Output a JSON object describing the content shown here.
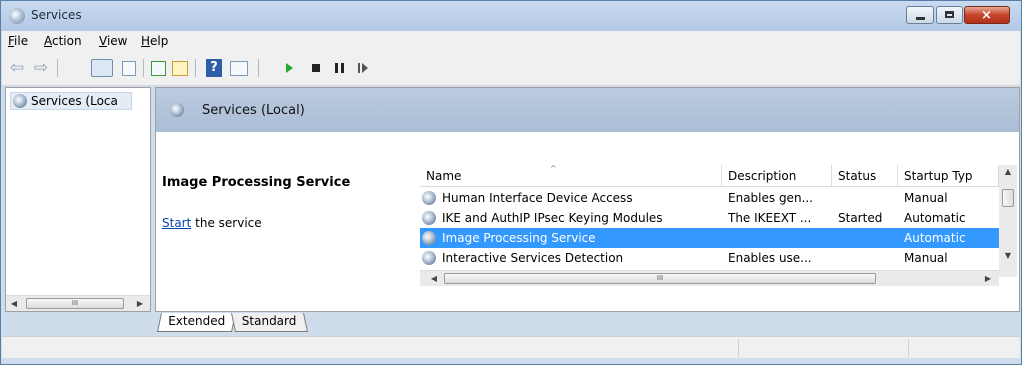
{
  "window": {
    "title": "Services",
    "caption_buttons": {
      "minimize": "minimize",
      "maximize": "maximize",
      "close": "×"
    }
  },
  "menubar": {
    "items": [
      "File",
      "Action",
      "View",
      "Help"
    ]
  },
  "toolbar": {
    "buttons": [
      "back-icon",
      "forward-icon",
      "show-hide-console-tree-icon",
      "properties-icon",
      "refresh-icon",
      "export-list-icon",
      "help-icon",
      "show-hide-action-pane-icon",
      "start-service-icon",
      "stop-service-icon",
      "pause-service-icon",
      "restart-service-icon"
    ],
    "help_glyph": "?"
  },
  "tree": {
    "item_label": "Services (Loca",
    "scroll_thumb": "III"
  },
  "main": {
    "header_title": "Services (Local)",
    "selected_service": "Image Processing Service",
    "action_link": "Start",
    "action_rest": " the service"
  },
  "list": {
    "columns": [
      "Name",
      "Description",
      "Status",
      "Startup Typ"
    ],
    "sort_glyph": "^",
    "rows": [
      {
        "name": "Human Interface Device Access",
        "description": "Enables gen...",
        "status": "",
        "startup": "Manual"
      },
      {
        "name": "IKE and AuthIP IPsec Keying Modules",
        "description": "The IKEEXT ...",
        "status": "Started",
        "startup": "Automatic"
      },
      {
        "name": "Image Processing Service",
        "description": "",
        "status": "",
        "startup": "Automatic"
      },
      {
        "name": "Interactive Services Detection",
        "description": "Enables use...",
        "status": "",
        "startup": "Manual"
      }
    ],
    "selected_index": 2,
    "hscroll_thumb": "III"
  },
  "tabs": {
    "extended": "Extended",
    "standard": "Standard"
  },
  "colors": {
    "selection": "#3399ff",
    "link": "#0645ad",
    "header_band": "#aabdd5"
  }
}
